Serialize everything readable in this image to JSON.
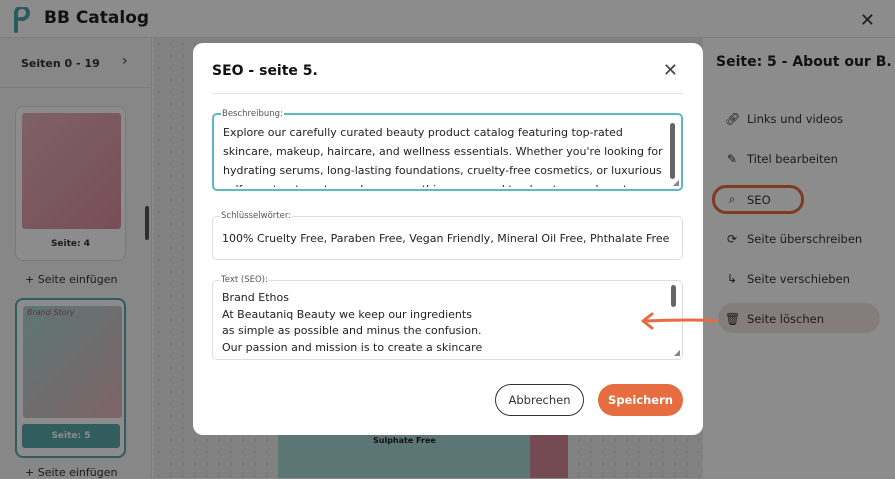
{
  "app": {
    "title": "BB Catalog"
  },
  "left_panel": {
    "pages_range": "Seiten 0 - 19",
    "thumbs": [
      {
        "caption": "Seite: 4"
      },
      {
        "caption": "Seite: 5"
      }
    ],
    "add_page_label": "+ Seite einfügen",
    "thumb_script_title": "Brand Story"
  },
  "canvas": {
    "preview_text": "Sulphate Free"
  },
  "right_panel": {
    "title": "Seite: 5 - About our B...",
    "items": [
      {
        "label": "Links und videos",
        "icon": "link-icon"
      },
      {
        "label": "Titel bearbeiten",
        "icon": "pencil-icon"
      },
      {
        "label": "SEO",
        "icon": "search-icon"
      },
      {
        "label": "Seite überschreiben",
        "icon": "refresh-icon"
      },
      {
        "label": "Seite verschieben",
        "icon": "move-icon"
      },
      {
        "label": "Seite löschen",
        "icon": "trash-icon"
      }
    ]
  },
  "modal": {
    "title": "SEO - seite 5.",
    "fields": {
      "description_label": "Beschreibung:",
      "description_value": "Explore our carefully curated beauty product catalog featuring top-rated skincare, makeup, haircare, and wellness essentials. Whether you're looking for hydrating serums, long-lasting foundations, cruelty-free cosmetics, or luxurious self-care treatments, we have everything you need to elevate your beauty routine.",
      "keywords_label": "Schlüsselwörter:",
      "keywords_value": "100% Cruelty Free, Paraben Free, Vegan Friendly, Mineral Oil Free, Phthalate Free, Sulphate Free",
      "seo_text_label": "Text (SEO):",
      "seo_text_value": "Brand Ethos\nAt Beautaniq Beauty we keep our ingredients\nas simple as possible and minus the confusion.\nOur passion and mission is to create a skincare"
    },
    "cancel_label": "Abbrechen",
    "save_label": "Speichern"
  },
  "colors": {
    "accent": "#e76c3f",
    "focus": "#5fb8bf",
    "thumb_active": "#5aa9ae"
  }
}
